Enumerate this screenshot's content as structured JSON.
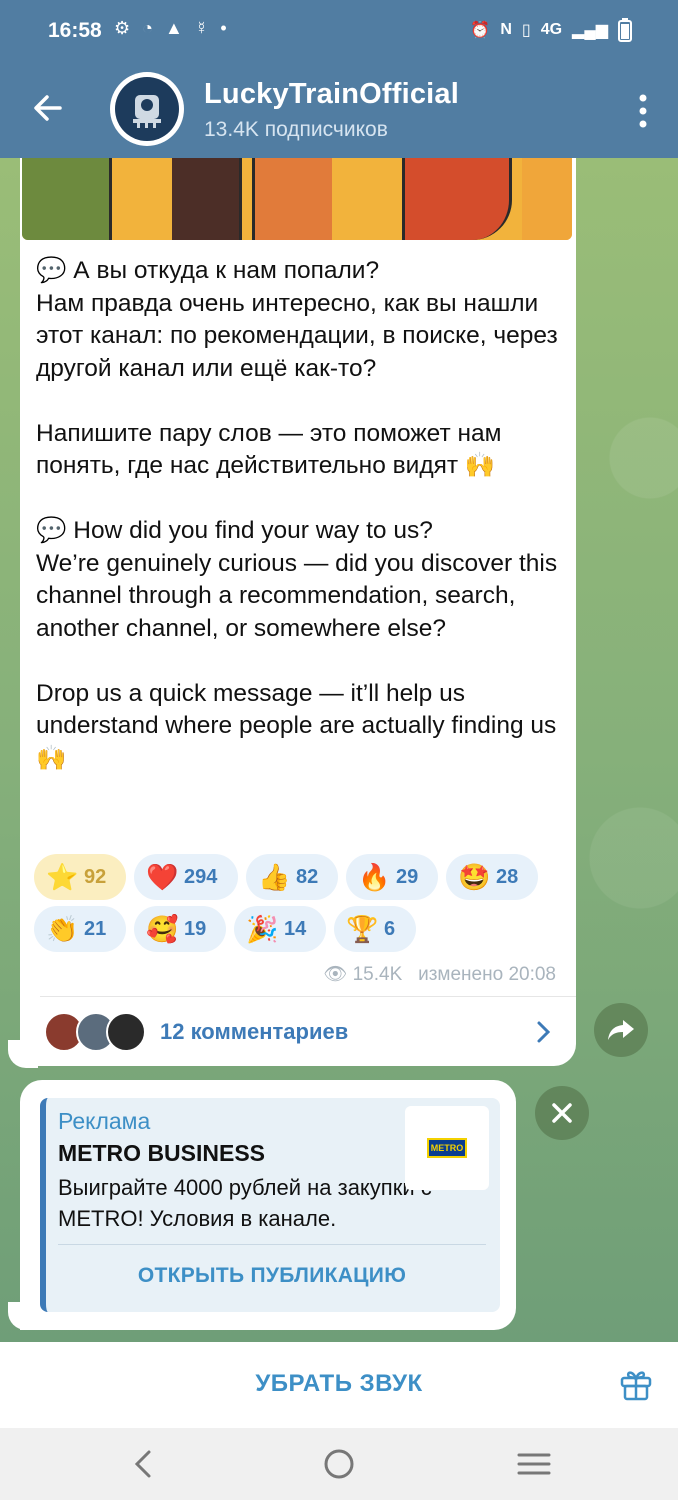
{
  "status_bar": {
    "time": "16:58",
    "left_icons": [
      "gear-icon",
      "whatsapp-icon",
      "warning-icon",
      "odnoklassniki-icon",
      "dot-icon"
    ],
    "right_text": "4G"
  },
  "header": {
    "title": "LuckyTrainOfficial",
    "subtitle": "13.4K подписчиков"
  },
  "message": {
    "paragraphs": [
      "💬 А вы откуда к нам попали?\nНам правда очень интересно, как вы нашли этот канал: по рекомендации, в поиске, через другой канал или ещё как-то?",
      "Напишите пару слов — это поможет нам понять, где нас действительно видят 🙌",
      "💬 How did you find your way to us?\nWe’re genuinely curious — did you discover this channel through a recommendation, search, another channel, or somewhere else?",
      "Drop us a quick message — it’ll help us understand where people are actually finding us 🙌"
    ],
    "reactions": [
      {
        "emoji": "⭐",
        "count": "92",
        "chosen": true
      },
      {
        "emoji": "❤️",
        "count": "294"
      },
      {
        "emoji": "👍",
        "count": "82"
      },
      {
        "emoji": "🔥",
        "count": "29"
      },
      {
        "emoji": "🤩",
        "count": "28"
      },
      {
        "emoji": "👏",
        "count": "21"
      },
      {
        "emoji": "🥰",
        "count": "19"
      },
      {
        "emoji": "🎉",
        "count": "14"
      },
      {
        "emoji": "🏆",
        "count": "6"
      }
    ],
    "views": "15.4K",
    "edited": "изменено 20:08",
    "comments_label": "12 комментариев"
  },
  "ad": {
    "label": "Реклама",
    "title": "METRO BUSINESS",
    "body": "Выиграйте 4000 рублей на закупки с METRO! Условия в канале.",
    "button": "ОТКРЫТЬ ПУБЛИКАЦИЮ",
    "logo_text": "METRO"
  },
  "bottom_bar": {
    "mute_label": "УБРАТЬ ЗВУК"
  },
  "colors": {
    "header": "#517da2",
    "accent": "#3d8fc6",
    "reaction_bg": "#e7f1fa"
  }
}
